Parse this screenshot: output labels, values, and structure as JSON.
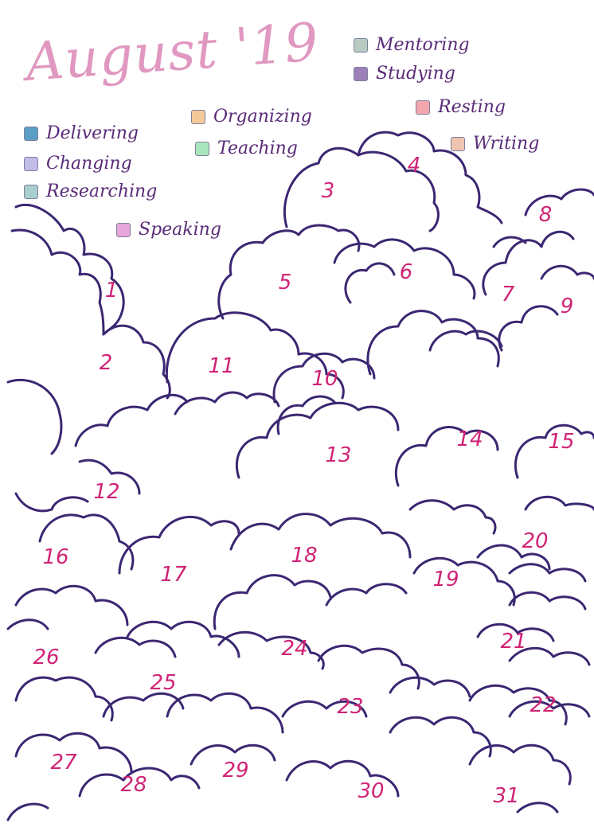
{
  "title": "August '19",
  "legend": [
    {
      "label": "Mentoring",
      "color": "#b8cbc1"
    },
    {
      "label": "Studying",
      "color": "#9d7fb9"
    },
    {
      "label": "Organizing",
      "color": "#f5c89a"
    },
    {
      "label": "Resting",
      "color": "#f4a6ad"
    },
    {
      "label": "Delivering",
      "color": "#5b9fc7"
    },
    {
      "label": "Teaching",
      "color": "#a9e6bd"
    },
    {
      "label": "Writing",
      "color": "#efc5b1"
    },
    {
      "label": "Changing",
      "color": "#c1bce8"
    },
    {
      "label": "Researching",
      "color": "#a8cfce"
    },
    {
      "label": "Speaking",
      "color": "#e6a6da"
    }
  ],
  "days": [
    "1",
    "2",
    "3",
    "4",
    "5",
    "6",
    "7",
    "8",
    "9",
    "10",
    "11",
    "12",
    "13",
    "14",
    "15",
    "16",
    "17",
    "18",
    "19",
    "20",
    "21",
    "22",
    "23",
    "24",
    "25",
    "26",
    "27",
    "28",
    "29",
    "30",
    "31"
  ]
}
